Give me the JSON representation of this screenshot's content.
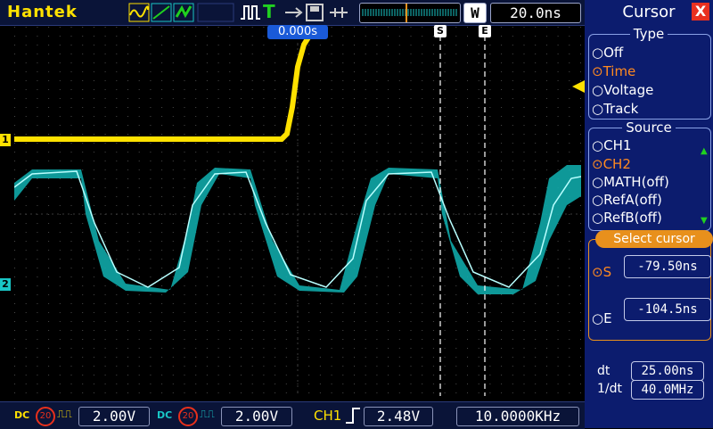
{
  "app": {
    "brand": "Hantek"
  },
  "toolbar": {
    "run_status_icon": "run-pulse-icon",
    "trigger_flag": "T",
    "timebase": "20.0ns",
    "mode_letter": "W",
    "colors": {
      "ch1": "#ffe100",
      "ch2": "#19c6c6",
      "accent": "#e8901c"
    }
  },
  "display": {
    "trigger_time_label": "0.000s",
    "cursor_s_marker": "S",
    "cursor_e_marker": "E",
    "ch1_marker": "1",
    "ch2_marker": "2"
  },
  "bottom": {
    "ch1_coupling": "DC",
    "ch1_bw": "20",
    "ch1_scale": "2.00V",
    "ch2_coupling": "DC",
    "ch2_bw": "20",
    "ch2_scale": "2.00V",
    "trigger_source": "CH1",
    "trigger_level": "2.48V",
    "frequency": "10.0000KHz"
  },
  "panel": {
    "title": "Cursor",
    "close": "X",
    "type_title": "Type",
    "type_options": [
      {
        "label": "Off",
        "selected": false
      },
      {
        "label": "Time",
        "selected": true
      },
      {
        "label": "Voltage",
        "selected": false
      },
      {
        "label": "Track",
        "selected": false
      }
    ],
    "source_title": "Source",
    "source_options": [
      {
        "label": "CH1",
        "selected": false
      },
      {
        "label": "CH2",
        "selected": true
      },
      {
        "label": "MATH(off)",
        "selected": false
      },
      {
        "label": "RefA(off)",
        "selected": false
      },
      {
        "label": "RefB(off)",
        "selected": false
      }
    ],
    "select_cursor_title": "Select cursor",
    "cursor_s_label": "S",
    "cursor_s_value": "-79.50ns",
    "cursor_e_label": "E",
    "cursor_e_value": "-104.5ns",
    "dt_label": "dt",
    "dt_value": "25.00ns",
    "inv_dt_label": "1/dt",
    "inv_dt_value": "40.0MHz"
  }
}
